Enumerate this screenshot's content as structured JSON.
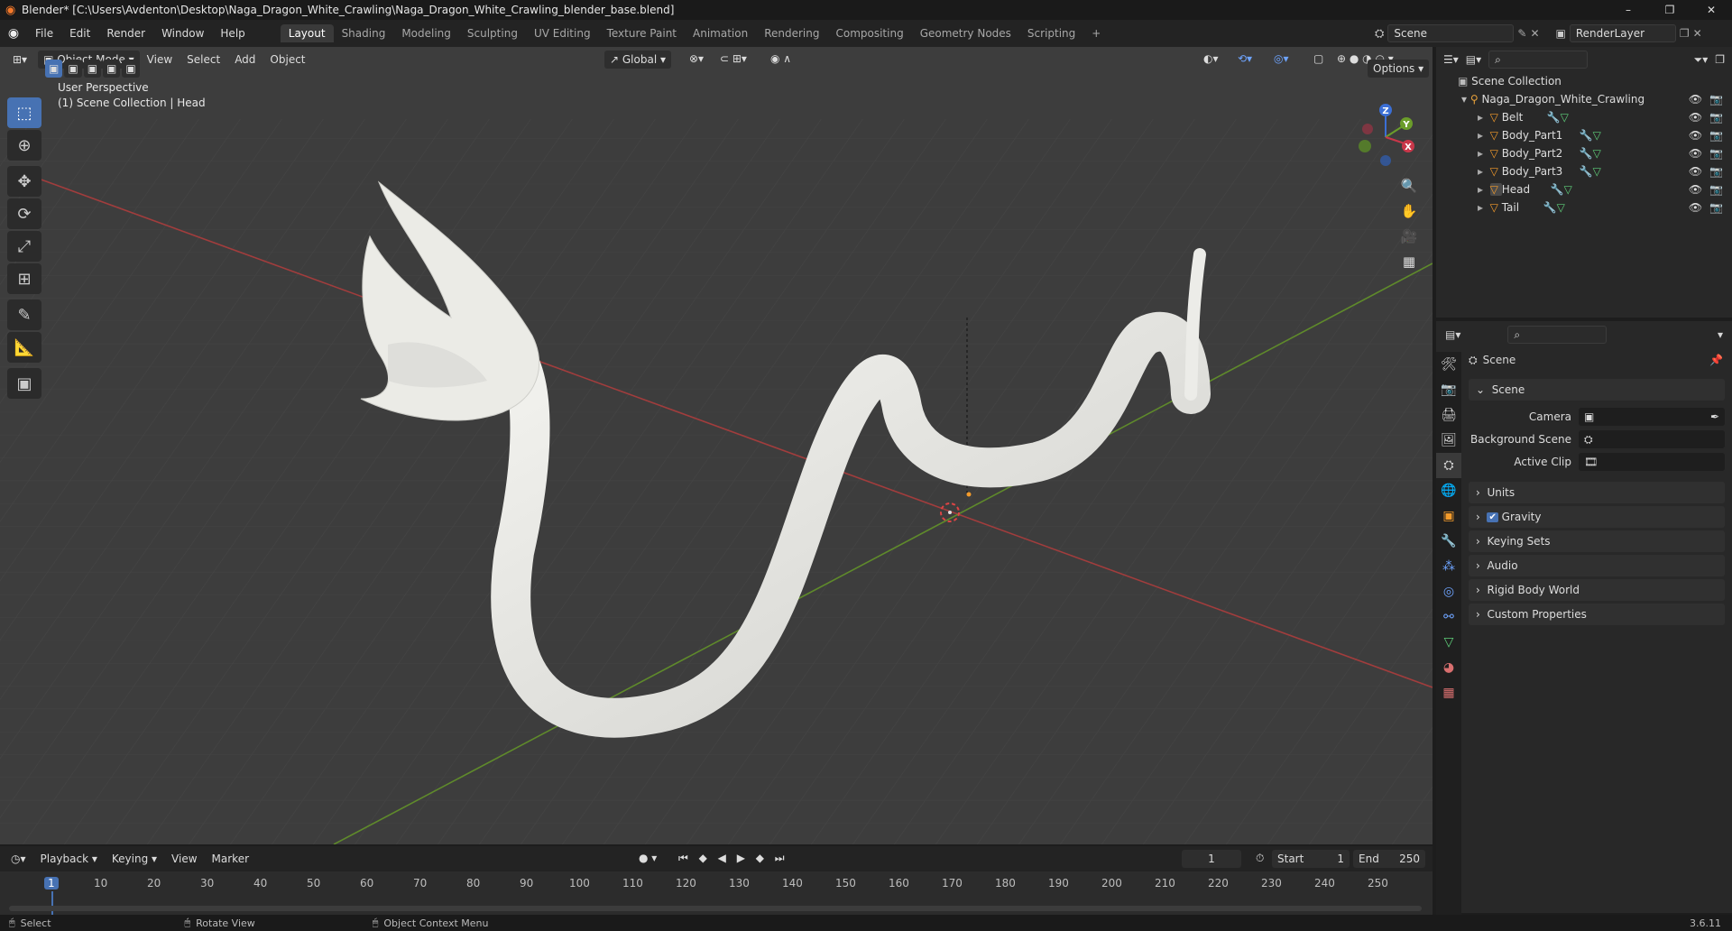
{
  "window": {
    "title": "Blender* [C:\\Users\\Avdenton\\Desktop\\Naga_Dragon_White_Crawling\\Naga_Dragon_White_Crawling_blender_base.blend]",
    "minimize": "–",
    "maximize": "❐",
    "close": "✕"
  },
  "menu": [
    "File",
    "Edit",
    "Render",
    "Window",
    "Help"
  ],
  "workspaces": [
    "Layout",
    "Shading",
    "Modeling",
    "Sculpting",
    "UV Editing",
    "Texture Paint",
    "Animation",
    "Rendering",
    "Compositing",
    "Geometry Nodes",
    "Scripting"
  ],
  "workspace_add": "+",
  "scene_field": "Scene",
  "renderlayer_field": "RenderLayer",
  "viewport": {
    "mode": "Object Mode",
    "menus": [
      "View",
      "Select",
      "Add",
      "Object"
    ],
    "transform": "Global",
    "options": "Options",
    "perspective": "User Perspective",
    "collection_info": "(1) Scene Collection | Head",
    "gizmo": {
      "z": "Z",
      "y": "Y",
      "x": "X"
    }
  },
  "outliner": {
    "root": "Scene Collection",
    "collection": "Naga_Dragon_White_Crawling",
    "objects": [
      "Belt",
      "Body_Part1",
      "Body_Part2",
      "Body_Part3",
      "Head",
      "Tail"
    ]
  },
  "properties": {
    "context": "Scene",
    "panel": "Scene",
    "camera_label": "Camera",
    "background_label": "Background Scene",
    "clip_label": "Active Clip",
    "sections": [
      "Units",
      "Gravity",
      "Keying Sets",
      "Audio",
      "Rigid Body World",
      "Custom Properties"
    ]
  },
  "timeline": {
    "menus": [
      "Playback",
      "Keying",
      "View",
      "Marker"
    ],
    "current_frame": "1",
    "start_label": "Start",
    "start": "1",
    "end_label": "End",
    "end": "250",
    "ruler": [
      "1",
      "10",
      "20",
      "30",
      "40",
      "50",
      "60",
      "70",
      "80",
      "90",
      "100",
      "110",
      "120",
      "130",
      "140",
      "150",
      "160",
      "170",
      "180",
      "190",
      "200",
      "210",
      "220",
      "230",
      "240",
      "250"
    ]
  },
  "status": {
    "select": "Select",
    "rotate": "Rotate View",
    "context_menu": "Object Context Menu",
    "version": "3.6.11"
  }
}
